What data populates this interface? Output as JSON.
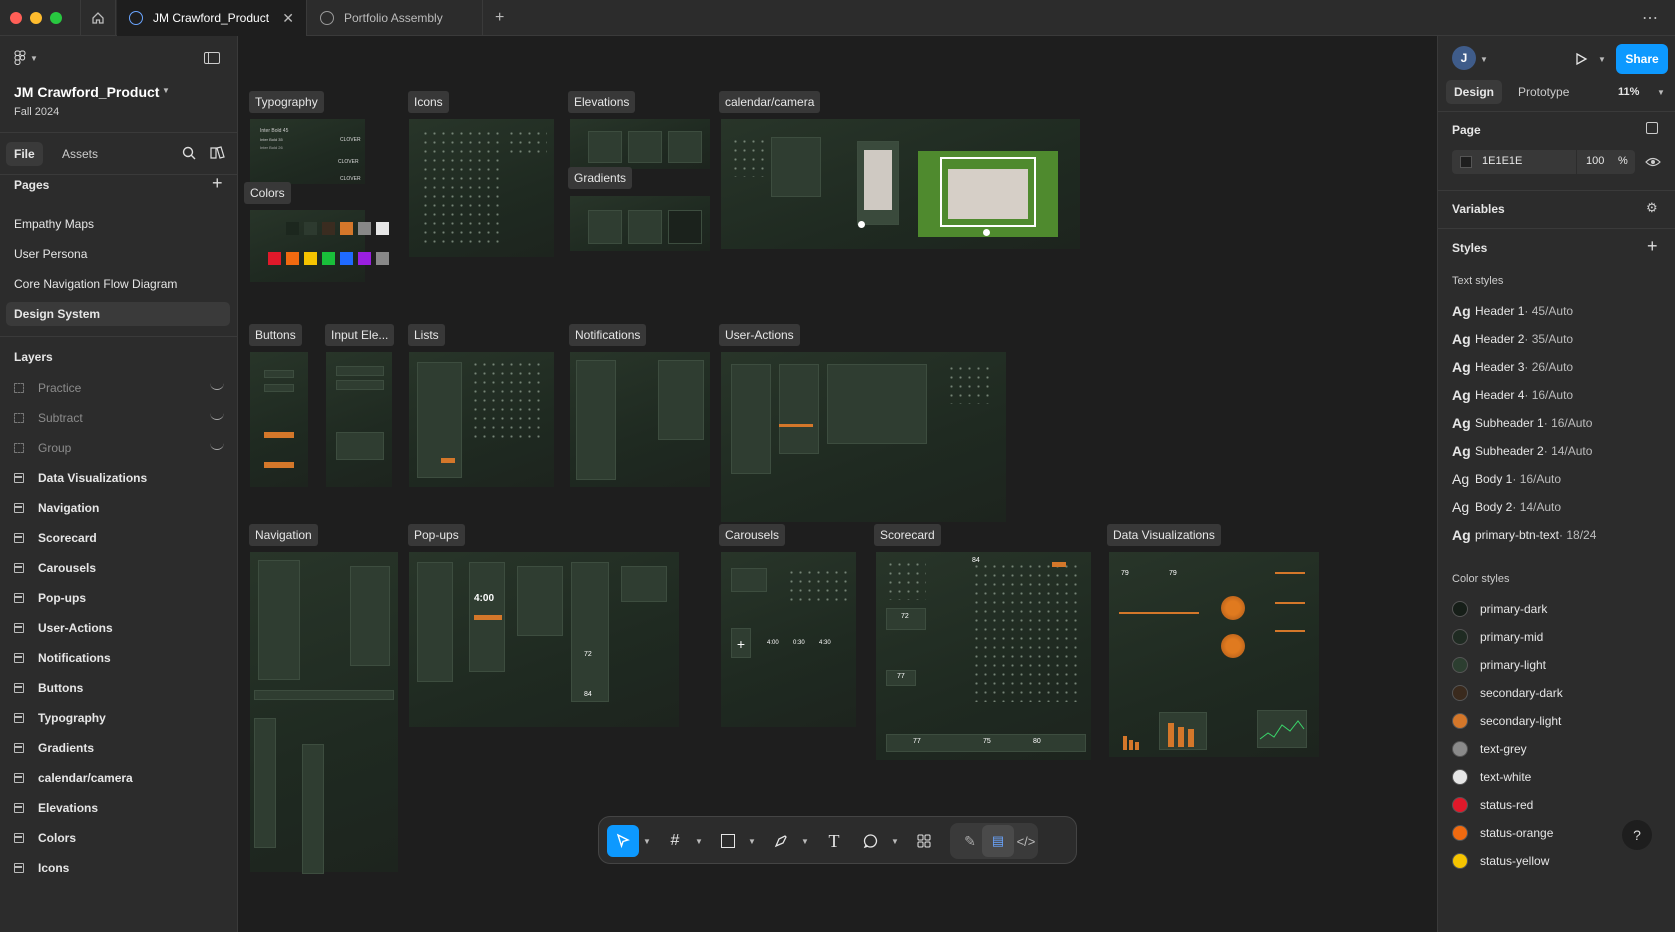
{
  "tabs": [
    {
      "label": "JM Crawford_Product"
    },
    {
      "label": "Portfolio Assembly"
    }
  ],
  "file": {
    "name": "JM Crawford_Product",
    "subtitle": "Fall 2024"
  },
  "left_tabs": {
    "file": "File",
    "assets": "Assets"
  },
  "pages_header": "Pages",
  "pages": [
    "Empathy Maps",
    "User Persona",
    "Core Navigation Flow Diagram",
    "Design System"
  ],
  "layers_header": "Layers",
  "layers": [
    "Practice",
    "Subtract",
    "Group",
    "Data Visualizations",
    "Navigation",
    "Scorecard",
    "Carousels",
    "Pop-ups",
    "User-Actions",
    "Notifications",
    "Buttons",
    "Typography",
    "Gradients",
    "calendar/camera",
    "Elevations",
    "Colors",
    "Icons"
  ],
  "canvas_frames": {
    "typography": "Typography",
    "icons": "Icons",
    "elevations": "Elevations",
    "calendar": "calendar/camera",
    "colors": "Colors",
    "gradients": "Gradients",
    "buttons": "Buttons",
    "input": "Input Ele...",
    "lists": "Lists",
    "notifications": "Notifications",
    "user_actions": "User-Actions",
    "navigation": "Navigation",
    "popups": "Pop-ups",
    "carousels": "Carousels",
    "scorecard": "Scorecard",
    "dataviz": "Data Visualizations"
  },
  "canvas_text": {
    "clover1": "CLOVER",
    "clover2": "CLOVER",
    "clover3": "CLOVER",
    "time": "4:00",
    "time2": "4:00",
    "t3": "0:30",
    "t4": "4:30",
    "n72": "72",
    "n84": "84",
    "n77": "77",
    "n80": "80",
    "n75": "75",
    "n79": "79",
    "typo1": "Inter Bold 45",
    "typo2": "Inter Bold 35",
    "typo3": "Inter Bold 26"
  },
  "right_panel": {
    "avatar": "J",
    "share": "Share",
    "tabs": {
      "design": "Design",
      "prototype": "Prototype"
    },
    "zoom": "11%",
    "page_header": "Page",
    "page_color": "1E1E1E",
    "page_opacity": "100",
    "percent": "%",
    "variables": "Variables",
    "styles": "Styles",
    "text_styles_header": "Text styles",
    "ag": "Ag",
    "text_styles": [
      {
        "name": "Header 1",
        "spec": " · 45/Auto"
      },
      {
        "name": "Header 2",
        "spec": " · 35/Auto"
      },
      {
        "name": "Header 3",
        "spec": " · 26/Auto"
      },
      {
        "name": "Header 4",
        "spec": " · 16/Auto"
      },
      {
        "name": "Subheader 1",
        "spec": " · 16/Auto"
      },
      {
        "name": "Subheader 2",
        "spec": " · 14/Auto"
      },
      {
        "name": "Body 1",
        "spec": " · 16/Auto"
      },
      {
        "name": "Body 2",
        "spec": " · 14/Auto"
      },
      {
        "name": "primary-btn-text",
        "spec": " · 18/24"
      }
    ],
    "color_styles_header": "Color styles",
    "color_styles": [
      {
        "name": "primary-dark",
        "color": "#161e18"
      },
      {
        "name": "primary-mid",
        "color": "#1f2b22"
      },
      {
        "name": "primary-light",
        "color": "#2c3e30"
      },
      {
        "name": "secondary-dark",
        "color": "#3a2a1d"
      },
      {
        "name": "secondary-light",
        "color": "#d4772a"
      },
      {
        "name": "text-grey",
        "color": "#8a8a8a"
      },
      {
        "name": "text-white",
        "color": "#e6e6e6"
      },
      {
        "name": "status-red",
        "color": "#e0192a"
      },
      {
        "name": "status-orange",
        "color": "#f06a10"
      },
      {
        "name": "status-yellow",
        "color": "#f5c400"
      }
    ],
    "help": "?"
  },
  "icons": {
    "home": "home-icon",
    "figma_menu": "figma-menu-icon",
    "search": "search-icon",
    "play": "play-icon"
  }
}
